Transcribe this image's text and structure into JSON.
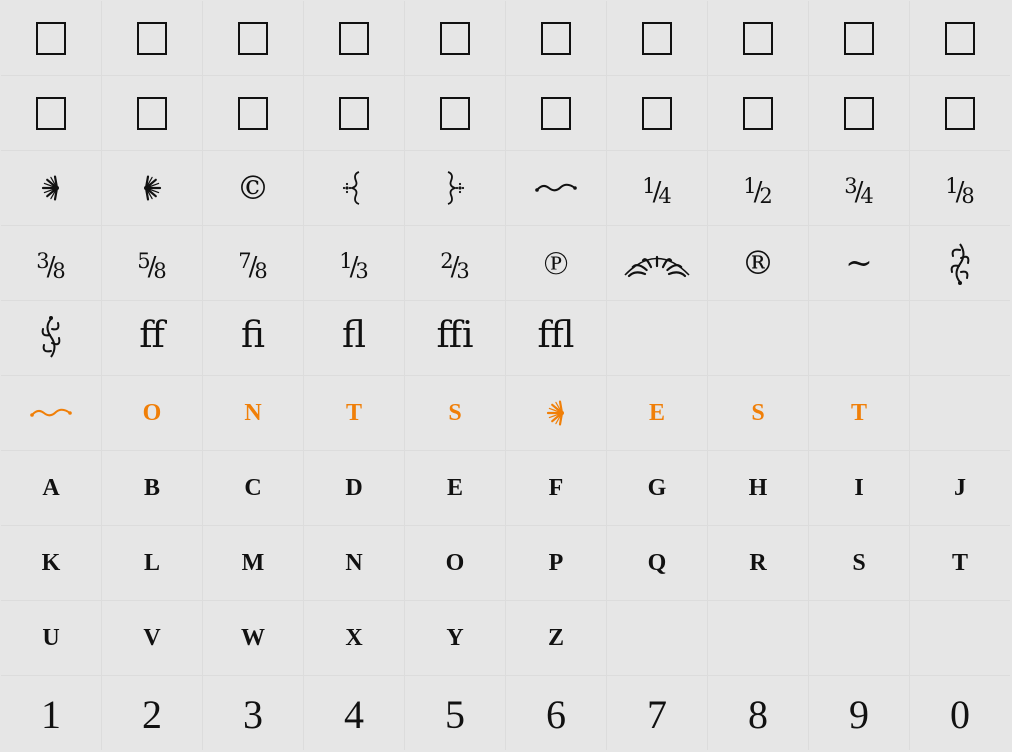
{
  "accent_color": "#f07f08",
  "grid": {
    "rows": [
      [
        {
          "kind": "tofu",
          "name": "missing-glyph-box-icon"
        },
        {
          "kind": "tofu",
          "name": "missing-glyph-box-icon"
        },
        {
          "kind": "tofu",
          "name": "missing-glyph-box-icon"
        },
        {
          "kind": "tofu",
          "name": "missing-glyph-box-icon"
        },
        {
          "kind": "tofu",
          "name": "missing-glyph-box-icon"
        },
        {
          "kind": "tofu",
          "name": "missing-glyph-box-icon"
        },
        {
          "kind": "tofu",
          "name": "missing-glyph-box-icon"
        },
        {
          "kind": "tofu",
          "name": "missing-glyph-box-icon"
        },
        {
          "kind": "tofu",
          "name": "missing-glyph-box-icon"
        },
        {
          "kind": "tofu",
          "name": "missing-glyph-box-icon"
        }
      ],
      [
        {
          "kind": "tofu",
          "name": "missing-glyph-box-icon"
        },
        {
          "kind": "tofu",
          "name": "missing-glyph-box-icon"
        },
        {
          "kind": "tofu",
          "name": "missing-glyph-box-icon"
        },
        {
          "kind": "tofu",
          "name": "missing-glyph-box-icon"
        },
        {
          "kind": "tofu",
          "name": "missing-glyph-box-icon"
        },
        {
          "kind": "tofu",
          "name": "missing-glyph-box-icon"
        },
        {
          "kind": "tofu",
          "name": "missing-glyph-box-icon"
        },
        {
          "kind": "tofu",
          "name": "missing-glyph-box-icon"
        },
        {
          "kind": "tofu",
          "name": "missing-glyph-box-icon"
        },
        {
          "kind": "tofu",
          "name": "missing-glyph-box-icon"
        }
      ],
      [
        {
          "kind": "orn",
          "orn": "fan",
          "dir": "right",
          "name": "fan-ornament-right-icon"
        },
        {
          "kind": "orn",
          "orn": "fan",
          "dir": "left",
          "name": "fan-ornament-left-icon"
        },
        {
          "kind": "text",
          "text": "©",
          "cls": "sym",
          "name": "copyright-glyph"
        },
        {
          "kind": "orn",
          "orn": "brace",
          "dir": "left",
          "name": "brace-ornament-left-icon"
        },
        {
          "kind": "orn",
          "orn": "brace",
          "dir": "right",
          "name": "brace-ornament-right-icon"
        },
        {
          "kind": "orn",
          "orn": "swash",
          "name": "swash-ornament-icon"
        },
        {
          "kind": "frac",
          "n": "1",
          "d": "4",
          "name": "fraction-one-quarter"
        },
        {
          "kind": "frac",
          "n": "1",
          "d": "2",
          "name": "fraction-one-half"
        },
        {
          "kind": "frac",
          "n": "3",
          "d": "4",
          "name": "fraction-three-quarters"
        },
        {
          "kind": "frac",
          "n": "1",
          "d": "8",
          "name": "fraction-one-eighth"
        }
      ],
      [
        {
          "kind": "frac",
          "n": "3",
          "d": "8",
          "name": "fraction-three-eighths"
        },
        {
          "kind": "frac",
          "n": "5",
          "d": "8",
          "name": "fraction-five-eighths"
        },
        {
          "kind": "frac",
          "n": "7",
          "d": "8",
          "name": "fraction-seven-eighths"
        },
        {
          "kind": "frac",
          "n": "1",
          "d": "3",
          "name": "fraction-one-third"
        },
        {
          "kind": "frac",
          "n": "2",
          "d": "3",
          "name": "fraction-two-thirds"
        },
        {
          "kind": "text",
          "text": "℗",
          "cls": "sym",
          "name": "sound-recording-copyright-glyph"
        },
        {
          "kind": "orn",
          "orn": "arc",
          "name": "arc-ornament-icon"
        },
        {
          "kind": "text",
          "text": "®",
          "cls": "sym",
          "name": "registered-glyph"
        },
        {
          "kind": "text",
          "text": "~",
          "cls": "sym",
          "name": "tilde-glyph"
        },
        {
          "kind": "orn",
          "orn": "leaf",
          "dir": "up",
          "name": "leaf-ornament-up-icon"
        }
      ],
      [
        {
          "kind": "orn",
          "orn": "leaf",
          "dir": "down",
          "name": "leaf-ornament-down-icon"
        },
        {
          "kind": "text",
          "text": "ff",
          "cls": "lig",
          "name": "ff-ligature-glyph"
        },
        {
          "kind": "text",
          "text": "fi",
          "cls": "lig",
          "name": "fi-ligature-glyph"
        },
        {
          "kind": "text",
          "text": "fl",
          "cls": "lig",
          "name": "fl-ligature-glyph"
        },
        {
          "kind": "text",
          "text": "ffi",
          "cls": "lig",
          "name": "ffi-ligature-glyph"
        },
        {
          "kind": "text",
          "text": "ffl",
          "cls": "lig",
          "name": "ffl-ligature-glyph"
        },
        {
          "kind": "empty",
          "name": "empty-cell"
        },
        {
          "kind": "empty",
          "name": "empty-cell"
        },
        {
          "kind": "empty",
          "name": "empty-cell"
        },
        {
          "kind": "empty",
          "name": "empty-cell"
        }
      ],
      [
        {
          "kind": "orn",
          "orn": "swash",
          "accent": true,
          "name": "swash-ornament-icon"
        },
        {
          "kind": "text",
          "text": "O",
          "cls": "upper accent",
          "name": "glyph-cell"
        },
        {
          "kind": "text",
          "text": "N",
          "cls": "upper accent",
          "name": "glyph-cell"
        },
        {
          "kind": "text",
          "text": "T",
          "cls": "upper accent",
          "name": "glyph-cell"
        },
        {
          "kind": "text",
          "text": "S",
          "cls": "upper accent",
          "name": "glyph-cell"
        },
        {
          "kind": "orn",
          "orn": "fan",
          "dir": "right",
          "accent": true,
          "name": "fan-ornament-right-icon"
        },
        {
          "kind": "text",
          "text": "E",
          "cls": "upper accent",
          "name": "glyph-cell"
        },
        {
          "kind": "text",
          "text": "S",
          "cls": "upper accent",
          "name": "glyph-cell"
        },
        {
          "kind": "text",
          "text": "T",
          "cls": "upper accent",
          "name": "glyph-cell"
        },
        {
          "kind": "empty",
          "name": "empty-cell"
        }
      ],
      [
        {
          "kind": "text",
          "text": "A",
          "cls": "upper",
          "name": "glyph-cell"
        },
        {
          "kind": "text",
          "text": "B",
          "cls": "upper",
          "name": "glyph-cell"
        },
        {
          "kind": "text",
          "text": "C",
          "cls": "upper",
          "name": "glyph-cell"
        },
        {
          "kind": "text",
          "text": "D",
          "cls": "upper",
          "name": "glyph-cell"
        },
        {
          "kind": "text",
          "text": "E",
          "cls": "upper",
          "name": "glyph-cell"
        },
        {
          "kind": "text",
          "text": "F",
          "cls": "upper",
          "name": "glyph-cell"
        },
        {
          "kind": "text",
          "text": "G",
          "cls": "upper",
          "name": "glyph-cell"
        },
        {
          "kind": "text",
          "text": "H",
          "cls": "upper",
          "name": "glyph-cell"
        },
        {
          "kind": "text",
          "text": "I",
          "cls": "upper",
          "name": "glyph-cell"
        },
        {
          "kind": "text",
          "text": "J",
          "cls": "upper",
          "name": "glyph-cell"
        }
      ],
      [
        {
          "kind": "text",
          "text": "K",
          "cls": "upper",
          "name": "glyph-cell"
        },
        {
          "kind": "text",
          "text": "L",
          "cls": "upper",
          "name": "glyph-cell"
        },
        {
          "kind": "text",
          "text": "M",
          "cls": "upper",
          "name": "glyph-cell"
        },
        {
          "kind": "text",
          "text": "N",
          "cls": "upper",
          "name": "glyph-cell"
        },
        {
          "kind": "text",
          "text": "O",
          "cls": "upper",
          "name": "glyph-cell"
        },
        {
          "kind": "text",
          "text": "P",
          "cls": "upper",
          "name": "glyph-cell"
        },
        {
          "kind": "text",
          "text": "Q",
          "cls": "upper",
          "name": "glyph-cell"
        },
        {
          "kind": "text",
          "text": "R",
          "cls": "upper",
          "name": "glyph-cell"
        },
        {
          "kind": "text",
          "text": "S",
          "cls": "upper",
          "name": "glyph-cell"
        },
        {
          "kind": "text",
          "text": "T",
          "cls": "upper",
          "name": "glyph-cell"
        }
      ],
      [
        {
          "kind": "text",
          "text": "U",
          "cls": "upper",
          "name": "glyph-cell"
        },
        {
          "kind": "text",
          "text": "V",
          "cls": "upper",
          "name": "glyph-cell"
        },
        {
          "kind": "text",
          "text": "W",
          "cls": "upper",
          "name": "glyph-cell"
        },
        {
          "kind": "text",
          "text": "X",
          "cls": "upper",
          "name": "glyph-cell"
        },
        {
          "kind": "text",
          "text": "Y",
          "cls": "upper",
          "name": "glyph-cell"
        },
        {
          "kind": "text",
          "text": "Z",
          "cls": "upper",
          "name": "glyph-cell"
        },
        {
          "kind": "empty",
          "name": "empty-cell"
        },
        {
          "kind": "empty",
          "name": "empty-cell"
        },
        {
          "kind": "empty",
          "name": "empty-cell"
        },
        {
          "kind": "empty",
          "name": "empty-cell"
        }
      ],
      [
        {
          "kind": "text",
          "text": "1",
          "cls": "digit",
          "name": "glyph-cell"
        },
        {
          "kind": "text",
          "text": "2",
          "cls": "digit",
          "name": "glyph-cell"
        },
        {
          "kind": "text",
          "text": "3",
          "cls": "digit",
          "name": "glyph-cell"
        },
        {
          "kind": "text",
          "text": "4",
          "cls": "digit",
          "name": "glyph-cell"
        },
        {
          "kind": "text",
          "text": "5",
          "cls": "digit",
          "name": "glyph-cell"
        },
        {
          "kind": "text",
          "text": "6",
          "cls": "digit",
          "name": "glyph-cell"
        },
        {
          "kind": "text",
          "text": "7",
          "cls": "digit",
          "name": "glyph-cell"
        },
        {
          "kind": "text",
          "text": "8",
          "cls": "digit",
          "name": "glyph-cell"
        },
        {
          "kind": "text",
          "text": "9",
          "cls": "digit",
          "name": "glyph-cell"
        },
        {
          "kind": "text",
          "text": "0",
          "cls": "digit",
          "name": "glyph-cell"
        }
      ]
    ]
  }
}
